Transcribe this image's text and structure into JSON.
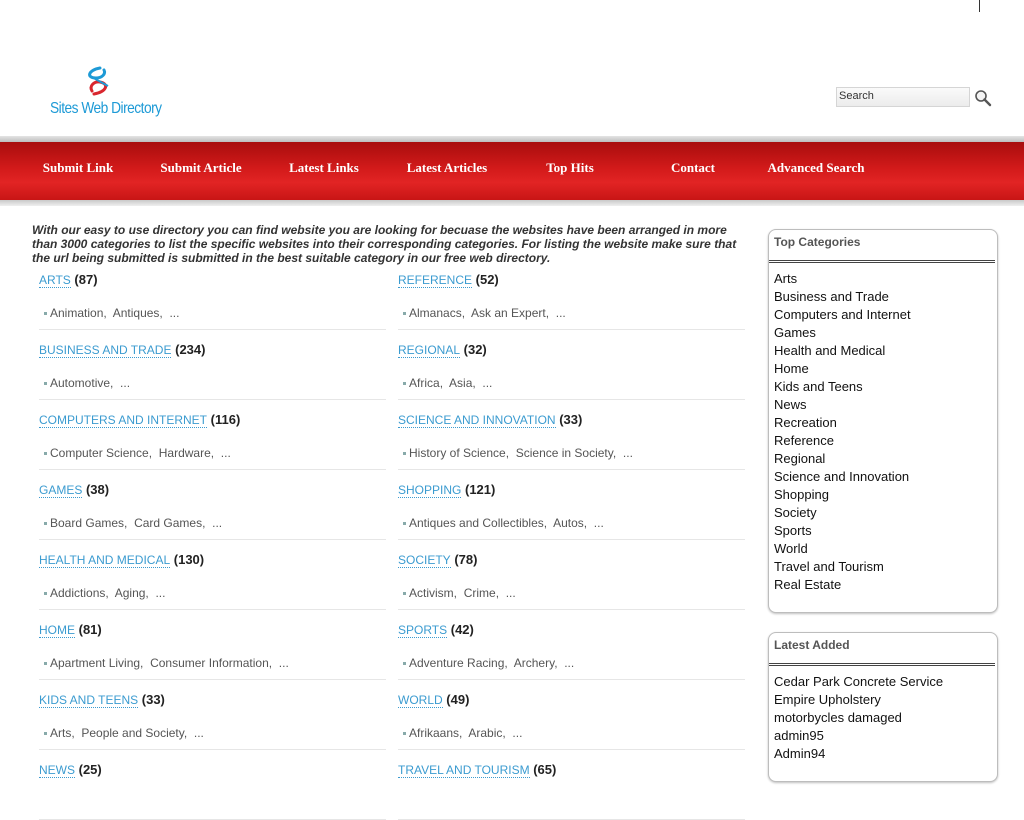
{
  "site": {
    "logo_text": "Sites Web Directory"
  },
  "search": {
    "value": "Search"
  },
  "nav": [
    {
      "label": "Submit Link"
    },
    {
      "label": "Submit Article"
    },
    {
      "label": "Latest Links"
    },
    {
      "label": "Latest Articles"
    },
    {
      "label": "Top Hits"
    },
    {
      "label": "Contact"
    },
    {
      "label": "Advanced Search"
    }
  ],
  "intro": "With our easy to use directory you can find website you are looking for becuase the websites have been arranged in more than 3000 categories to list the specific websites into their corresponding categories. For listing the website make sure that the url being submitted is submitted in the best suitable category in our free web directory.",
  "categories": [
    {
      "title": "ARTS",
      "count": "(87)",
      "subs": [
        "Animation",
        "Antiques",
        "..."
      ]
    },
    {
      "title": "REFERENCE",
      "count": "(52)",
      "subs": [
        "Almanacs",
        "Ask an Expert",
        "..."
      ]
    },
    {
      "title": "BUSINESS AND TRADE",
      "count": "(234)",
      "subs": [
        "Automotive",
        "..."
      ]
    },
    {
      "title": "REGIONAL",
      "count": "(32)",
      "subs": [
        "Africa",
        "Asia",
        "..."
      ]
    },
    {
      "title": "COMPUTERS AND INTERNET",
      "count": "(116)",
      "subs": [
        "Computer Science",
        "Hardware",
        "..."
      ]
    },
    {
      "title": "SCIENCE AND INNOVATION",
      "count": "(33)",
      "subs": [
        "History of Science",
        "Science in Society",
        "..."
      ]
    },
    {
      "title": "GAMES",
      "count": "(38)",
      "subs": [
        "Board Games",
        "Card Games",
        "..."
      ]
    },
    {
      "title": "SHOPPING",
      "count": "(121)",
      "subs": [
        "Antiques and Collectibles",
        "Autos",
        "..."
      ]
    },
    {
      "title": "HEALTH AND MEDICAL",
      "count": "(130)",
      "subs": [
        "Addictions",
        "Aging",
        "..."
      ]
    },
    {
      "title": "SOCIETY",
      "count": "(78)",
      "subs": [
        "Activism",
        "Crime",
        "..."
      ]
    },
    {
      "title": "HOME",
      "count": "(81)",
      "subs": [
        "Apartment Living",
        "Consumer Information",
        "..."
      ]
    },
    {
      "title": "SPORTS",
      "count": "(42)",
      "subs": [
        "Adventure Racing",
        "Archery",
        "..."
      ]
    },
    {
      "title": "KIDS AND TEENS",
      "count": "(33)",
      "subs": [
        "Arts",
        "People and Society",
        "..."
      ]
    },
    {
      "title": "WORLD",
      "count": "(49)",
      "subs": [
        "Afrikaans",
        "Arabic",
        "..."
      ]
    },
    {
      "title": "NEWS",
      "count": "(25)",
      "subs": []
    },
    {
      "title": "TRAVEL AND TOURISM",
      "count": "(65)",
      "subs": []
    }
  ],
  "top_categories": {
    "title": "Top Categories",
    "items": [
      "Arts",
      "Business and Trade",
      "Computers and Internet",
      "Games",
      "Health and Medical",
      "Home",
      "Kids and Teens",
      "News",
      "Recreation",
      "Reference",
      "Regional",
      "Science and Innovation",
      "Shopping",
      "Society",
      "Sports",
      "World",
      "Travel and Tourism",
      "Real Estate"
    ]
  },
  "latest_added": {
    "title": "Latest Added",
    "items": [
      "Cedar Park Concrete Service",
      "Empire Upholstery",
      "motorbycles damaged",
      "admin95",
      "Admin94"
    ]
  }
}
